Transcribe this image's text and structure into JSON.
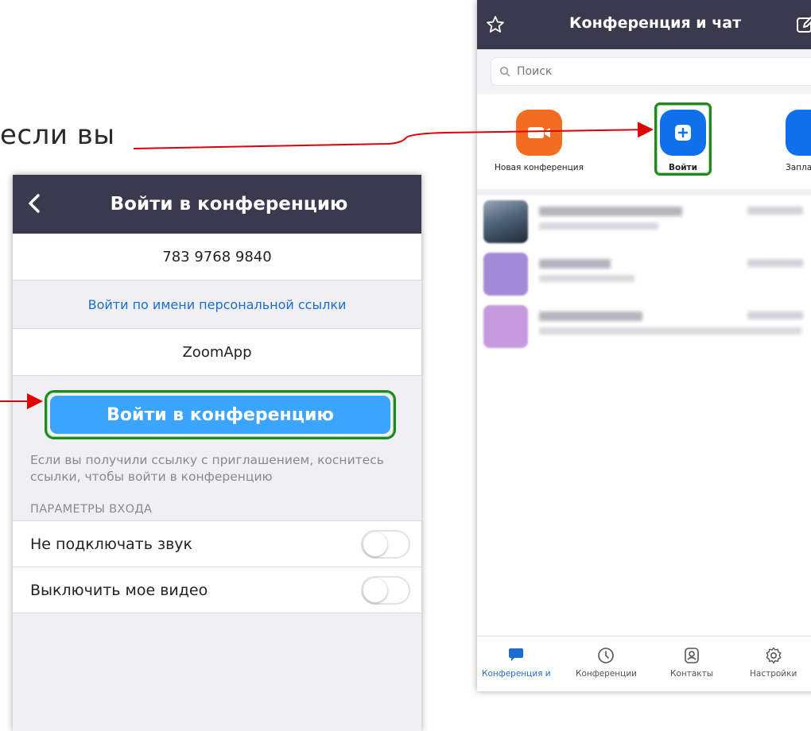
{
  "caption": {
    "text": "если вы"
  },
  "join_screen": {
    "title": "Войти в конференцию",
    "meeting_id": "783 9768 9840",
    "personal_link_label": "Войти по имени персональной ссылки",
    "display_name": "ZoomApp",
    "join_button": "Войти в конференцию",
    "hint": "Если вы получили ссылку с приглашением, коснитесь ссылки, чтобы войти в конференцию",
    "section_header": "ПАРАМЕТРЫ ВХОДА",
    "options": [
      {
        "label": "Не подключать звук",
        "on": false
      },
      {
        "label": "Выключить мое видео",
        "on": false
      }
    ]
  },
  "home_screen": {
    "title": "Конференция и чат",
    "search_placeholder": "Поиск",
    "actions": [
      {
        "label": "Новая конференция",
        "icon": "video-camera-icon",
        "color": "#f26d21"
      },
      {
        "label": "Войти",
        "icon": "plus-icon",
        "color": "#0e71eb"
      },
      {
        "label": "Запла",
        "icon": "calendar-icon",
        "color": "#0e71eb"
      }
    ],
    "tabs": [
      {
        "label": "Конференция и",
        "icon": "chat-bubble-icon",
        "active": true
      },
      {
        "label": "Конференции",
        "icon": "clock-icon",
        "active": false
      },
      {
        "label": "Контакты",
        "icon": "contacts-icon",
        "active": false
      },
      {
        "label": "Настройки",
        "icon": "gear-icon",
        "active": false
      }
    ]
  },
  "colors": {
    "navbar": "#3a3a4e",
    "primary_blue": "#3aa4ff",
    "link_blue": "#1b6ed1",
    "highlight_green": "#1e8a1e",
    "arrow_red": "#e00000"
  }
}
